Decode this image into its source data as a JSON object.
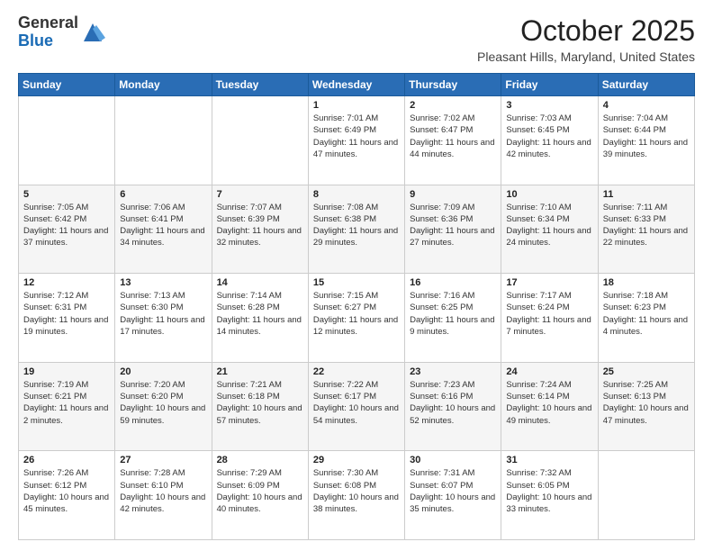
{
  "header": {
    "logo_line1": "General",
    "logo_line2": "Blue",
    "month_title": "October 2025",
    "location": "Pleasant Hills, Maryland, United States"
  },
  "days_of_week": [
    "Sunday",
    "Monday",
    "Tuesday",
    "Wednesday",
    "Thursday",
    "Friday",
    "Saturday"
  ],
  "rows": [
    [
      {
        "day": "",
        "info": ""
      },
      {
        "day": "",
        "info": ""
      },
      {
        "day": "",
        "info": ""
      },
      {
        "day": "1",
        "info": "Sunrise: 7:01 AM\nSunset: 6:49 PM\nDaylight: 11 hours and 47 minutes."
      },
      {
        "day": "2",
        "info": "Sunrise: 7:02 AM\nSunset: 6:47 PM\nDaylight: 11 hours and 44 minutes."
      },
      {
        "day": "3",
        "info": "Sunrise: 7:03 AM\nSunset: 6:45 PM\nDaylight: 11 hours and 42 minutes."
      },
      {
        "day": "4",
        "info": "Sunrise: 7:04 AM\nSunset: 6:44 PM\nDaylight: 11 hours and 39 minutes."
      }
    ],
    [
      {
        "day": "5",
        "info": "Sunrise: 7:05 AM\nSunset: 6:42 PM\nDaylight: 11 hours and 37 minutes."
      },
      {
        "day": "6",
        "info": "Sunrise: 7:06 AM\nSunset: 6:41 PM\nDaylight: 11 hours and 34 minutes."
      },
      {
        "day": "7",
        "info": "Sunrise: 7:07 AM\nSunset: 6:39 PM\nDaylight: 11 hours and 32 minutes."
      },
      {
        "day": "8",
        "info": "Sunrise: 7:08 AM\nSunset: 6:38 PM\nDaylight: 11 hours and 29 minutes."
      },
      {
        "day": "9",
        "info": "Sunrise: 7:09 AM\nSunset: 6:36 PM\nDaylight: 11 hours and 27 minutes."
      },
      {
        "day": "10",
        "info": "Sunrise: 7:10 AM\nSunset: 6:34 PM\nDaylight: 11 hours and 24 minutes."
      },
      {
        "day": "11",
        "info": "Sunrise: 7:11 AM\nSunset: 6:33 PM\nDaylight: 11 hours and 22 minutes."
      }
    ],
    [
      {
        "day": "12",
        "info": "Sunrise: 7:12 AM\nSunset: 6:31 PM\nDaylight: 11 hours and 19 minutes."
      },
      {
        "day": "13",
        "info": "Sunrise: 7:13 AM\nSunset: 6:30 PM\nDaylight: 11 hours and 17 minutes."
      },
      {
        "day": "14",
        "info": "Sunrise: 7:14 AM\nSunset: 6:28 PM\nDaylight: 11 hours and 14 minutes."
      },
      {
        "day": "15",
        "info": "Sunrise: 7:15 AM\nSunset: 6:27 PM\nDaylight: 11 hours and 12 minutes."
      },
      {
        "day": "16",
        "info": "Sunrise: 7:16 AM\nSunset: 6:25 PM\nDaylight: 11 hours and 9 minutes."
      },
      {
        "day": "17",
        "info": "Sunrise: 7:17 AM\nSunset: 6:24 PM\nDaylight: 11 hours and 7 minutes."
      },
      {
        "day": "18",
        "info": "Sunrise: 7:18 AM\nSunset: 6:23 PM\nDaylight: 11 hours and 4 minutes."
      }
    ],
    [
      {
        "day": "19",
        "info": "Sunrise: 7:19 AM\nSunset: 6:21 PM\nDaylight: 11 hours and 2 minutes."
      },
      {
        "day": "20",
        "info": "Sunrise: 7:20 AM\nSunset: 6:20 PM\nDaylight: 10 hours and 59 minutes."
      },
      {
        "day": "21",
        "info": "Sunrise: 7:21 AM\nSunset: 6:18 PM\nDaylight: 10 hours and 57 minutes."
      },
      {
        "day": "22",
        "info": "Sunrise: 7:22 AM\nSunset: 6:17 PM\nDaylight: 10 hours and 54 minutes."
      },
      {
        "day": "23",
        "info": "Sunrise: 7:23 AM\nSunset: 6:16 PM\nDaylight: 10 hours and 52 minutes."
      },
      {
        "day": "24",
        "info": "Sunrise: 7:24 AM\nSunset: 6:14 PM\nDaylight: 10 hours and 49 minutes."
      },
      {
        "day": "25",
        "info": "Sunrise: 7:25 AM\nSunset: 6:13 PM\nDaylight: 10 hours and 47 minutes."
      }
    ],
    [
      {
        "day": "26",
        "info": "Sunrise: 7:26 AM\nSunset: 6:12 PM\nDaylight: 10 hours and 45 minutes."
      },
      {
        "day": "27",
        "info": "Sunrise: 7:28 AM\nSunset: 6:10 PM\nDaylight: 10 hours and 42 minutes."
      },
      {
        "day": "28",
        "info": "Sunrise: 7:29 AM\nSunset: 6:09 PM\nDaylight: 10 hours and 40 minutes."
      },
      {
        "day": "29",
        "info": "Sunrise: 7:30 AM\nSunset: 6:08 PM\nDaylight: 10 hours and 38 minutes."
      },
      {
        "day": "30",
        "info": "Sunrise: 7:31 AM\nSunset: 6:07 PM\nDaylight: 10 hours and 35 minutes."
      },
      {
        "day": "31",
        "info": "Sunrise: 7:32 AM\nSunset: 6:05 PM\nDaylight: 10 hours and 33 minutes."
      },
      {
        "day": "",
        "info": ""
      }
    ]
  ]
}
